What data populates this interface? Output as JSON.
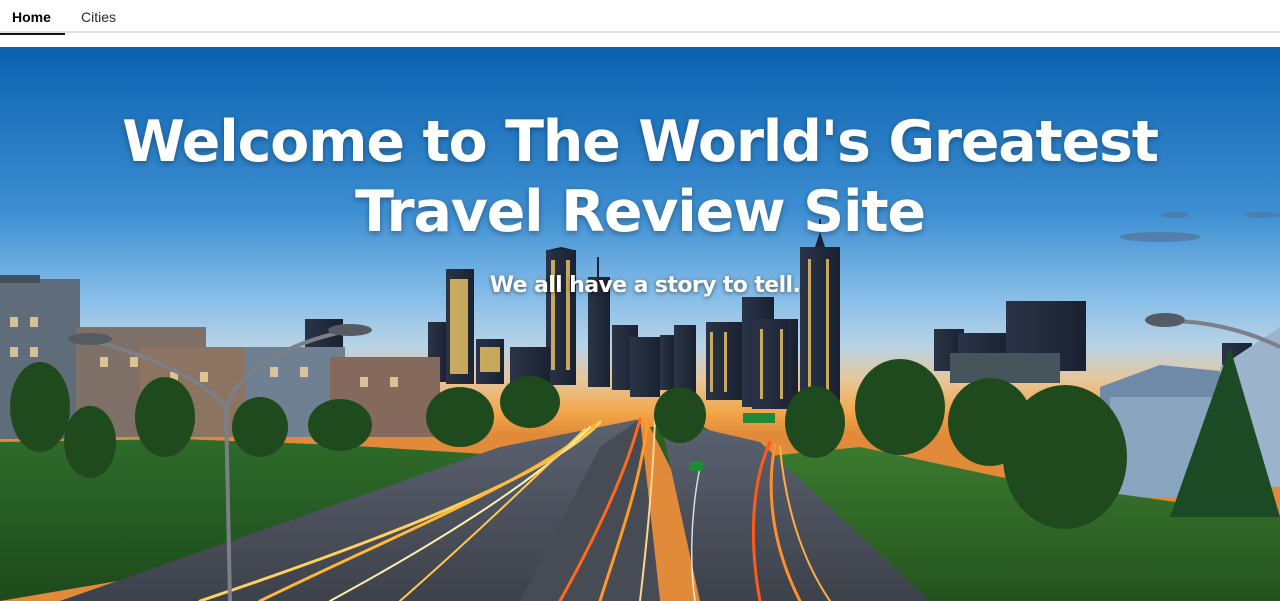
{
  "nav": {
    "tabs": [
      {
        "label": "Home",
        "active": true
      },
      {
        "label": "Cities",
        "active": false
      }
    ]
  },
  "hero": {
    "title": "Welcome to The World's Greatest Travel Review Site",
    "subtitle": "We all have a story to tell.",
    "image": "city-skyline-highway-at-dusk"
  },
  "colors": {
    "sky_top": "#0a66b4",
    "sky_mid": "#6cb0e4",
    "horizon": "#f0a040",
    "grass": "#2f6a25",
    "road": "#4a4e58",
    "light_trail": "#ffb020",
    "tab_indicator": "#111111"
  }
}
